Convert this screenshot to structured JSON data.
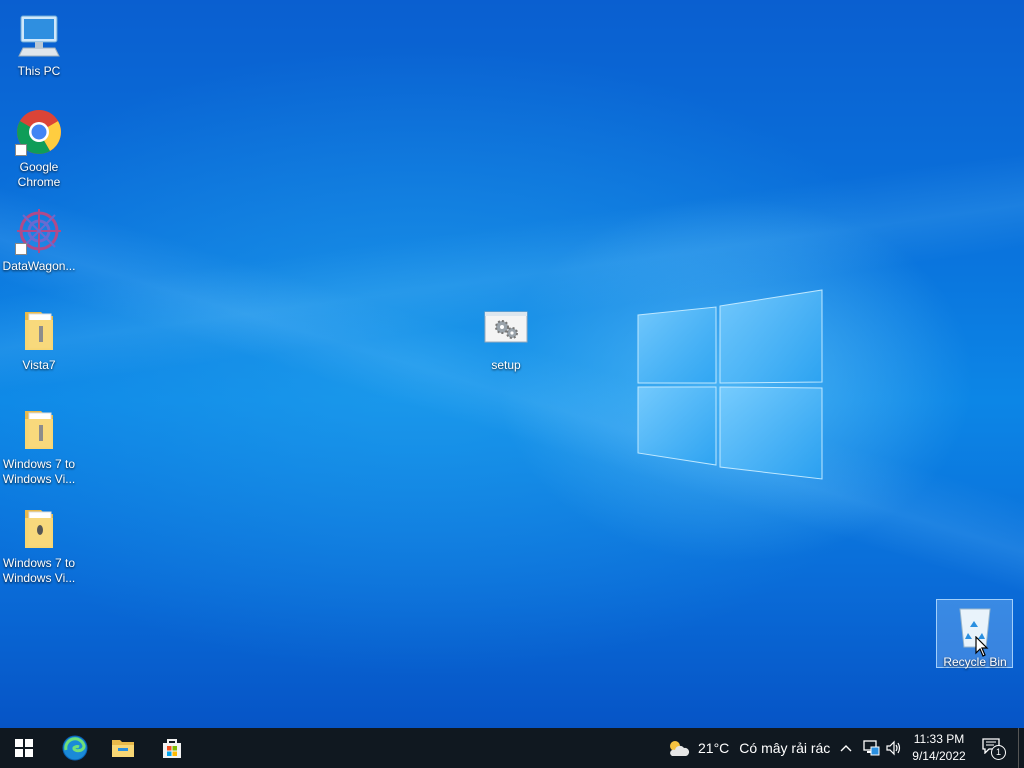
{
  "desktop": {
    "icons": [
      {
        "label": "This PC"
      },
      {
        "label": "Google Chrome"
      },
      {
        "label": "DataWagon..."
      },
      {
        "label": "Vista7"
      },
      {
        "label": "Windows 7 to Windows Vi..."
      },
      {
        "label": "Windows 7 to Windows Vi..."
      },
      {
        "label": "setup"
      },
      {
        "label": "Recycle Bin"
      }
    ]
  },
  "taskbar": {
    "pinned": [
      "windows-start",
      "microsoft-edge",
      "file-explorer",
      "microsoft-store"
    ],
    "weather": {
      "temp": "21°C",
      "condition": "Có mây rải rác",
      "icon": "partly-cloudy-icon"
    },
    "clock": {
      "time": "11:33 PM",
      "date": "9/14/2022"
    },
    "notification_count": "1"
  },
  "colors": {
    "taskbar_bg": "#101820",
    "accent": "#0a74dd"
  }
}
